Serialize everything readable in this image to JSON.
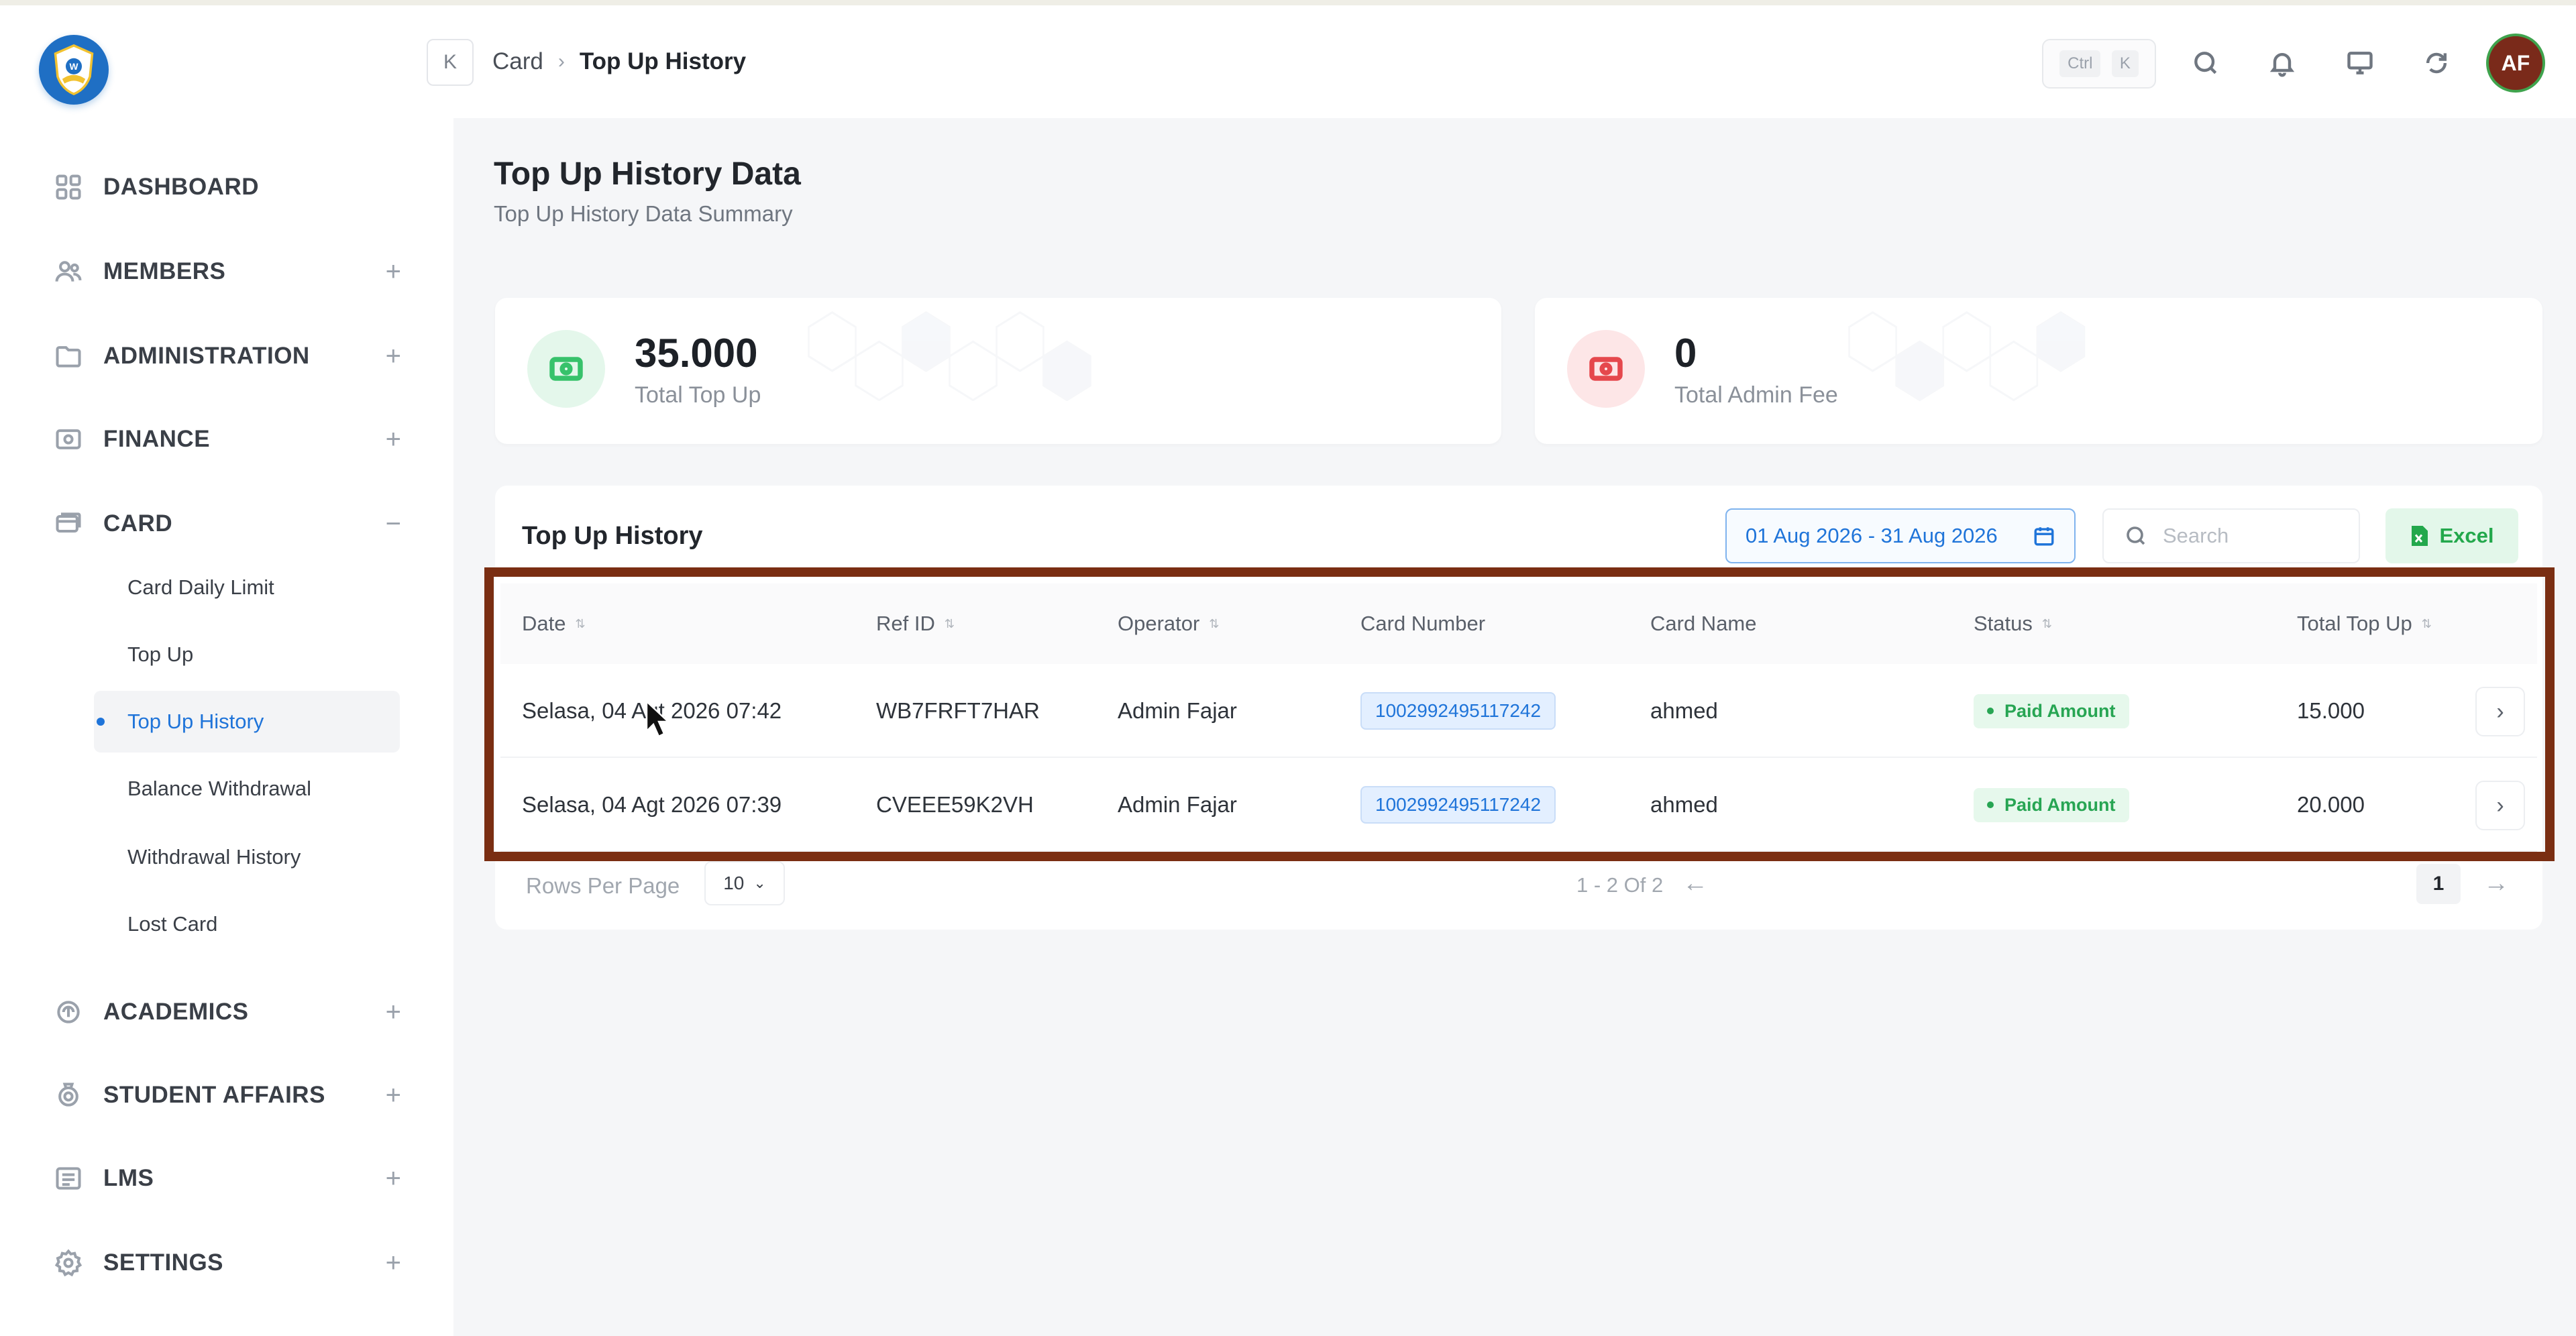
{
  "sidebar": {
    "items": [
      {
        "label": "DASHBOARD",
        "icon": "grid-icon",
        "toggle": ""
      },
      {
        "label": "MEMBERS",
        "icon": "users-icon",
        "toggle": "+"
      },
      {
        "label": "ADMINISTRATION",
        "icon": "folder-icon",
        "toggle": "+"
      },
      {
        "label": "FINANCE",
        "icon": "money-icon",
        "toggle": "+"
      },
      {
        "label": "CARD",
        "icon": "card-icon",
        "toggle": "−"
      },
      {
        "label": "ACADEMICS",
        "icon": "academic-icon",
        "toggle": "+"
      },
      {
        "label": "STUDENT AFFAIRS",
        "icon": "award-icon",
        "toggle": "+"
      },
      {
        "label": "LMS",
        "icon": "list-icon",
        "toggle": "+"
      },
      {
        "label": "SETTINGS",
        "icon": "gear-icon",
        "toggle": "+"
      }
    ],
    "card_submenu": [
      "Card Daily Limit",
      "Top Up",
      "Top Up History",
      "Balance Withdrawal",
      "Withdrawal History",
      "Lost Card"
    ]
  },
  "header": {
    "breadcrumb": [
      "Card",
      "Top Up History"
    ],
    "kbd": [
      "Ctrl",
      "K"
    ],
    "avatar": "AF",
    "collapse": "K"
  },
  "page": {
    "title": "Top Up History Data",
    "subtitle": "Top Up History Data Summary"
  },
  "stats": [
    {
      "value": "35.000",
      "label": "Total Top Up",
      "color": "#37c26b"
    },
    {
      "value": "0",
      "label": "Total Admin Fee",
      "color": "#e5484d"
    }
  ],
  "table": {
    "title": "Top Up History",
    "date_range": "01 Aug 2026 - 31 Aug 2026",
    "search_placeholder": "Search",
    "excel_label": "Excel",
    "columns": [
      "Date",
      "Ref ID",
      "Operator",
      "Card Number",
      "Card Name",
      "Status",
      "Total Top Up"
    ],
    "rows": [
      {
        "date": "Selasa, 04 Agt 2026 07:42",
        "ref": "WB7FRFT7HAR",
        "operator": "Admin Fajar",
        "card_number": "1002992495117242",
        "card_name": "ahmed",
        "status": "Paid Amount",
        "total": "15.000"
      },
      {
        "date": "Selasa, 04 Agt 2026 07:39",
        "ref": "CVEEE59K2VH",
        "operator": "Admin Fajar",
        "card_number": "1002992495117242",
        "card_name": "ahmed",
        "status": "Paid Amount",
        "total": "20.000"
      }
    ],
    "rows_per_page_label": "Rows Per Page",
    "rows_per_page": "10",
    "page_info": "1 - 2 Of 2",
    "current_page": "1"
  },
  "colors": {
    "accent": "#1f74d9",
    "highlight": "#7a2e12"
  }
}
